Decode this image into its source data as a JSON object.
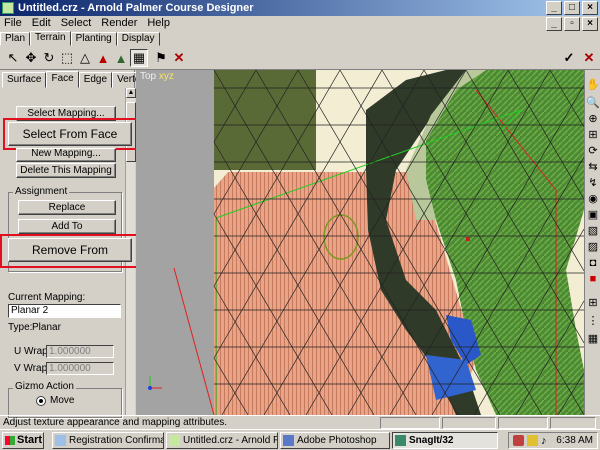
{
  "window": {
    "title": "Untitled.crz - Arnold Palmer Course Designer"
  },
  "menu": [
    "File",
    "Edit",
    "Select",
    "Render",
    "Help"
  ],
  "main_tabs": [
    "Plan",
    "Terrain",
    "Planting",
    "Display"
  ],
  "panel": {
    "tabs": [
      "Surface",
      "Face",
      "Edge",
      "Vertex"
    ],
    "select_mapping": "Select Mapping...",
    "select_from_face": "Select From Face",
    "new_mapping": "New Mapping...",
    "delete_mapping": "Delete This Mapping",
    "assignment_label": "Assignment",
    "replace": "Replace",
    "add_to": "Add To",
    "remove_from": "Remove From",
    "current_mapping_label": "Current Mapping:",
    "current_mapping_value": "Planar 2",
    "type_label": "Type:",
    "type_value": "Planar",
    "u_wrap_label": "U Wrap:",
    "u_wrap_value": "1.000000",
    "v_wrap_label": "V Wrap:",
    "v_wrap_value": "1.000000",
    "gizmo_label": "Gizmo Action",
    "move_label": "Move"
  },
  "viewport": {
    "view_name": "Top",
    "axes": "xyz"
  },
  "status": {
    "text": "Adjust texture appearance and mapping attributes."
  },
  "taskbar": {
    "start": "Start",
    "items": [
      "Registration Confirmatio...",
      "Untitled.crz - Arnold Pal...",
      "Adobe Photoshop",
      "SnagIt/32"
    ],
    "clock": "6:38 AM"
  },
  "colors": {
    "highlight_box": "#e01020",
    "title_bar": "#0a246a",
    "terrain_salmon": "#e8a488",
    "fairway_green": "#5a8a3a"
  }
}
